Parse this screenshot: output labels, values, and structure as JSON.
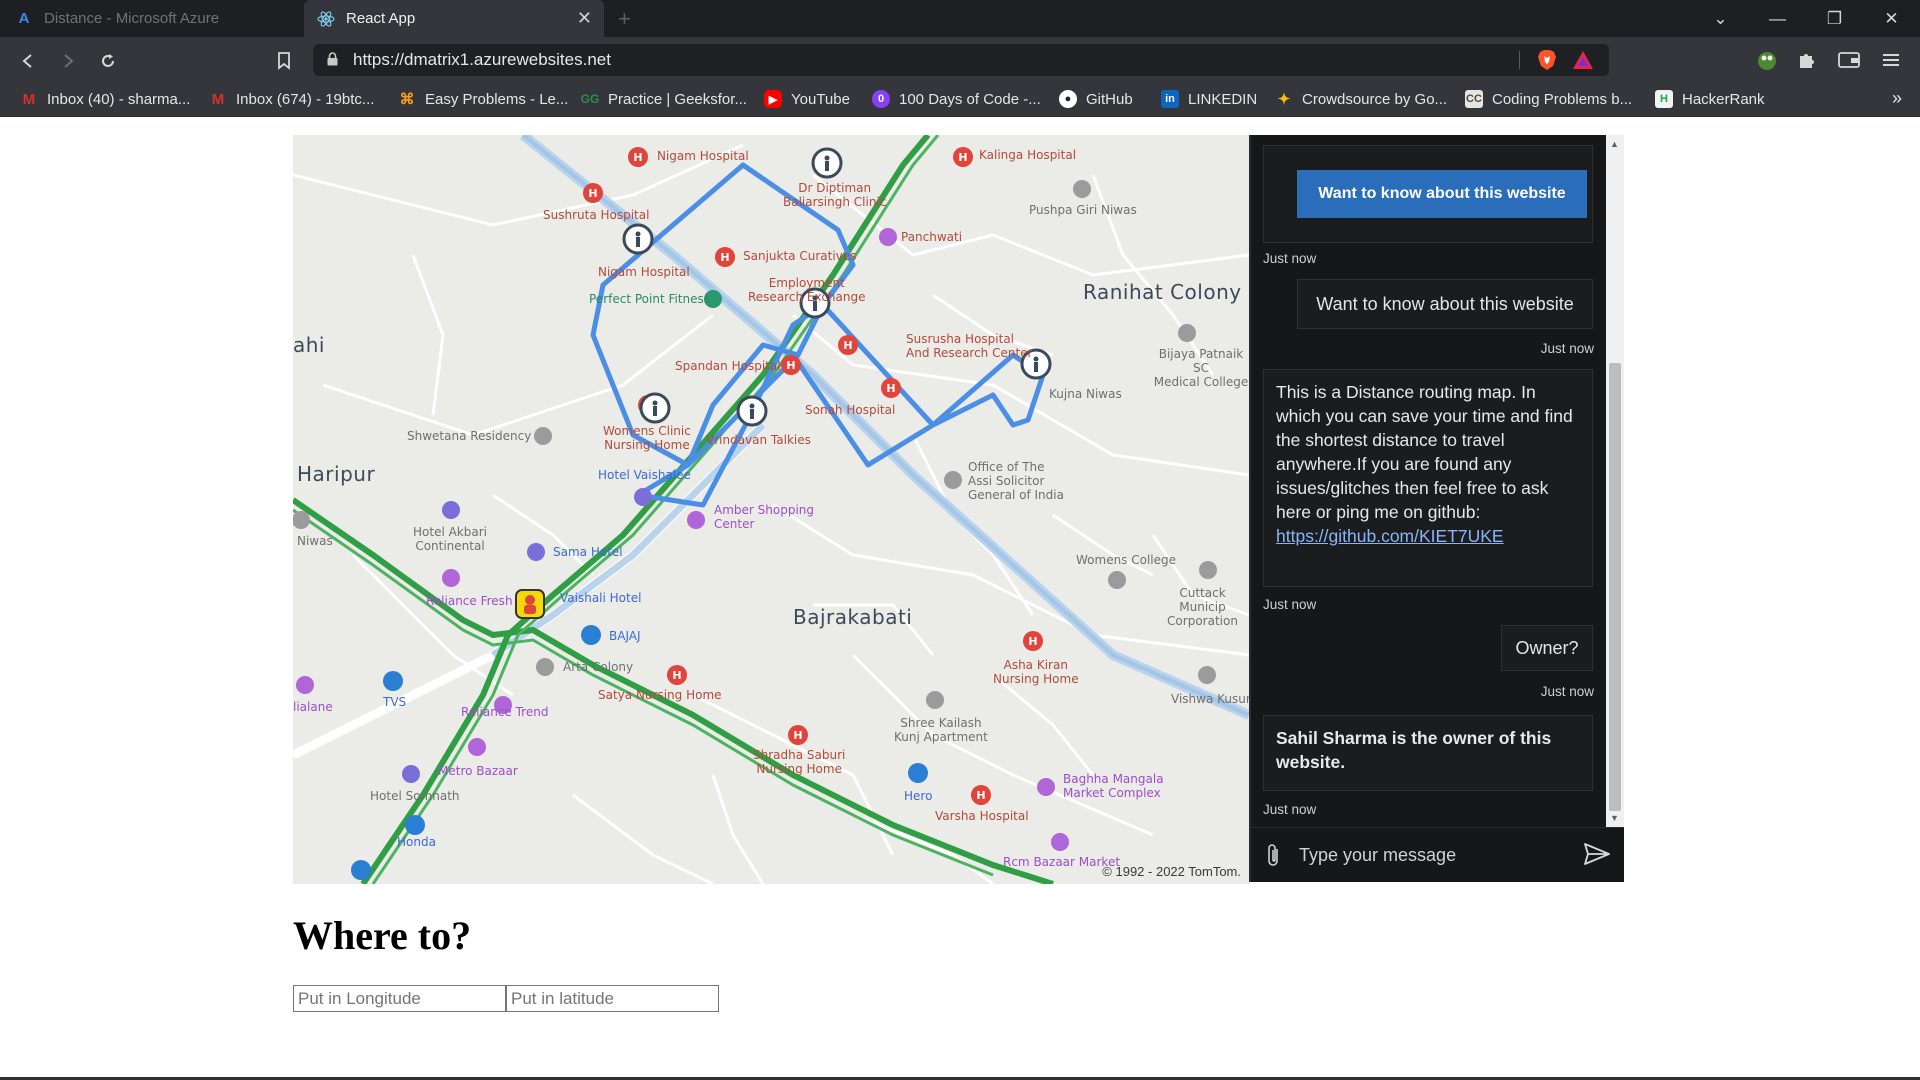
{
  "browser": {
    "tabs": [
      {
        "title": "Distance - Microsoft Azure",
        "active": false
      },
      {
        "title": "React App",
        "active": true
      }
    ],
    "url": "https://dmatrix1.azurewebsites.net",
    "bookmarks": [
      {
        "label": "Inbox (40) - sharma...",
        "icon": "gmail-icon",
        "color": "#d93025"
      },
      {
        "label": "Inbox (674) - 19btc...",
        "icon": "gmail-icon",
        "color": "#d93025"
      },
      {
        "label": "Easy Problems - Le...",
        "icon": "leetcode-icon",
        "color": "#f89f1b"
      },
      {
        "label": "Practice | Geeksfor...",
        "icon": "geeksforgeeks-icon",
        "color": "#2f8d46"
      },
      {
        "label": "YouTube",
        "icon": "youtube-icon",
        "color": "#ff0000"
      },
      {
        "label": "100 Days of Code -...",
        "icon": "hundred-days-icon",
        "color": "#8a3ffc"
      },
      {
        "label": "GitHub",
        "icon": "github-icon",
        "color": "#ffffff"
      },
      {
        "label": "LINKEDIN",
        "icon": "linkedin-icon",
        "color": "#0a66c2"
      },
      {
        "label": "Crowdsource by Go...",
        "icon": "crowdsource-icon",
        "color": "#fbbc04"
      },
      {
        "label": "Coding Problems b...",
        "icon": "codechef-icon",
        "color": "#9a6c4f"
      },
      {
        "label": "HackerRank",
        "icon": "hackerrank-icon",
        "color": "#1ba94c"
      }
    ],
    "more_label": "»"
  },
  "map": {
    "area_labels": {
      "ranihat": "Ranihat Colony",
      "sahi": "ahi",
      "haripur": "Haripur",
      "bajrakabati": "Bajrakabati"
    },
    "poi": {
      "nigam_hospital": "Nigam Hospital",
      "kalinga": "Kalinga Hospital",
      "dr_diptiman": "Dr Diptiman\nBaliarsingh Clinic",
      "sushruta": "Sushruta Hospital",
      "panchwati": "Panchwati",
      "pushpa": "Pushpa Giri Niwas",
      "nigam2": "Nigam Hospital",
      "sanjukta": "Sanjukta Curatives",
      "employment": "Employment\nResearch Exchange",
      "perfect_point": "Perfect Point Fitness",
      "spandan": "Spandan Hospital",
      "susrusha": "Susrusha Hospital\nAnd Research Center",
      "bijaya": "Bijaya Patnaik SC\nMedical College",
      "kujna": "Kujna Niwas",
      "sonah": "Sonah Hospital",
      "shwetana": "Shwetana Residency",
      "womens_clinic": "Womens Clinic\nNursing Home",
      "vrindavan": "Vrindavan Talkies",
      "office": "Office of The\nAssi Solicitor\nGeneral of India",
      "hotel_vaishalee": "Hotel Vaishalee",
      "amber": "Amber Shopping\nCenter",
      "niwas": "Niwas",
      "hotel_akbari": "Hotel Akbari\nContinental",
      "sama": "Sama Hotel",
      "womens_college": "Womens College",
      "cuttack": "Cuttack Municip\nCorporation",
      "reliance_fresh": "Reliance Fresh",
      "vaishali": "Vaishali Hotel",
      "bajaj": "BAJAJ",
      "arta": "Arta Colony",
      "asha": "Asha Kiran\nNursing Home",
      "satya": "Satya Nursing Home",
      "vishwa": "Vishwa Kusum",
      "tvs": "TVS",
      "lialane": "lialane",
      "reliance_trend": "Reliance Trend",
      "shree": "Shree Kailash\nKunj Apartment",
      "shradha": "Shradha Saburi\nNursing Home",
      "metro": "Metro Bazaar",
      "hotel_somnath": "Hotel Somnath",
      "hero": "Hero",
      "baghha": "Baghha Mangala\nMarket Complex",
      "varsha": "Varsha Hospital",
      "honda": "Honda",
      "rcm": "Rcm Bazaar Market"
    },
    "copyright": "© 1992 - 2022 TomTom."
  },
  "chat": {
    "hero_button": "Want to know about this website",
    "messages": [
      {
        "from": "bot",
        "type": "card",
        "time": "Just now"
      },
      {
        "from": "user",
        "text": "Want to know about this website",
        "time": "Just now"
      },
      {
        "from": "bot",
        "text": "This is a Distance routing map. In which you can save your time and find the shortest distance to travel anywhere.If you are found any issues/glitches then feel free to ask here or ping me on github: ",
        "link": "https://github.com/KIET7UKE",
        "time": "Just now"
      },
      {
        "from": "user",
        "text": "Owner?",
        "time": "Just now"
      },
      {
        "from": "bot",
        "text": "Sahil Sharma is the owner of this website.",
        "time": "Just now"
      }
    ],
    "input_placeholder": "Type your message"
  },
  "page": {
    "title": "Where to?",
    "longitude_placeholder": "Put in Longitude",
    "latitude_placeholder": "Put in latitude"
  },
  "colors": {
    "route": "#4a8ee6",
    "green_road": "#2f9e44",
    "chat_button": "#2a6ebb",
    "hospital": "#e0443a"
  }
}
